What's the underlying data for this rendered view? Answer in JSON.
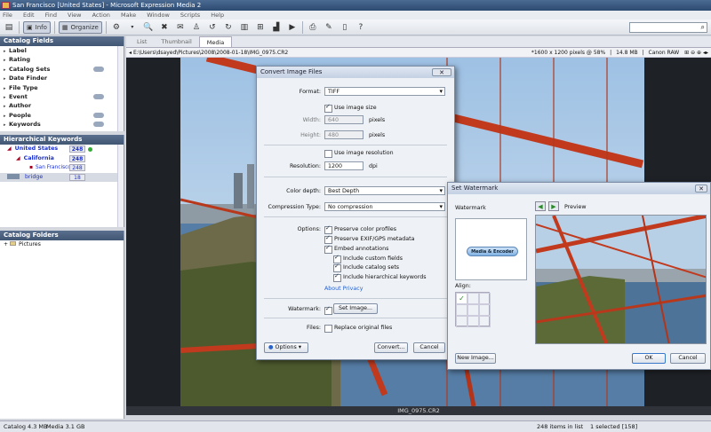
{
  "window": {
    "title": "San Francisco [United States] - Microsoft Expression Media 2"
  },
  "menu": [
    "File",
    "Edit",
    "Find",
    "View",
    "Action",
    "Make",
    "Window",
    "Scripts",
    "Help"
  ],
  "toolbar": {
    "info_label": "Info",
    "organize_label": "Organize"
  },
  "catalog_fields": {
    "title": "Catalog Fields",
    "items": [
      "Label",
      "Rating",
      "Catalog Sets",
      "Date Finder",
      "File Type",
      "Event",
      "Author",
      "People",
      "Keywords"
    ]
  },
  "hierarchical_keywords": {
    "title": "Hierarchical Keywords",
    "items": [
      {
        "label": "United States",
        "count": "248"
      },
      {
        "label": "California",
        "count": "248"
      },
      {
        "label": "San Francisco",
        "count": "248"
      },
      {
        "label": "bridge",
        "count": "18"
      }
    ]
  },
  "catalog_folders": {
    "title": "Catalog Folders",
    "items": [
      "Pictures"
    ]
  },
  "tabs": [
    "List",
    "Thumbnail",
    "Media"
  ],
  "path": "E:\\Users\\dsayed\\Pictures\\2008\\2008-01-18\\IMG_0975.CR2",
  "image_info": {
    "dimensions": "*1600 x 1200 pixels @ 58%",
    "size": "14.8 MB",
    "camera": "Canon RAW"
  },
  "filename": "IMG_0975.CR2",
  "status": {
    "catalog": "Catalog 4.3 MB",
    "media": "Media 3.1 GB",
    "items": "248 items in list",
    "selected": "1 selected [158]"
  },
  "convert_dialog": {
    "title": "Convert Image Files",
    "format_label": "Format:",
    "format_value": "TIFF",
    "use_image_size": "Use image size",
    "width_label": "Width:",
    "width_value": "640",
    "width_unit": "pixels",
    "height_label": "Height:",
    "height_value": "480",
    "height_unit": "pixels",
    "use_image_resolution": "Use image resolution",
    "resolution_label": "Resolution:",
    "resolution_value": "1200",
    "resolution_unit": "dpi",
    "color_depth_label": "Color depth:",
    "color_depth_value": "Best Depth",
    "compression_label": "Compression Type:",
    "compression_value": "No compression",
    "options_label": "Options:",
    "preserve_color": "Preserve color profiles",
    "preserve_exif": "Preserve EXIF/GPS metadata",
    "embed_annotations": "Embed annotations",
    "include_custom": "Include custom fields",
    "include_catalog": "Include catalog sets",
    "include_hier": "Include hierarchical keywords",
    "about_privacy": "About Privacy",
    "watermark_label": "Watermark:",
    "set_image": "Set Image...",
    "files_label": "Files:",
    "replace_files": "Replace original files",
    "options_btn": "Options",
    "convert_btn": "Convert...",
    "cancel_btn": "Cancel"
  },
  "watermark_dialog": {
    "title": "Set Watermark",
    "watermark_label": "Watermark",
    "watermark_text": "Media & Encoder",
    "align_label": "Align:",
    "preview_label": "Preview",
    "new_image_btn": "New Image...",
    "ok_btn": "OK",
    "cancel_btn": "Cancel"
  }
}
